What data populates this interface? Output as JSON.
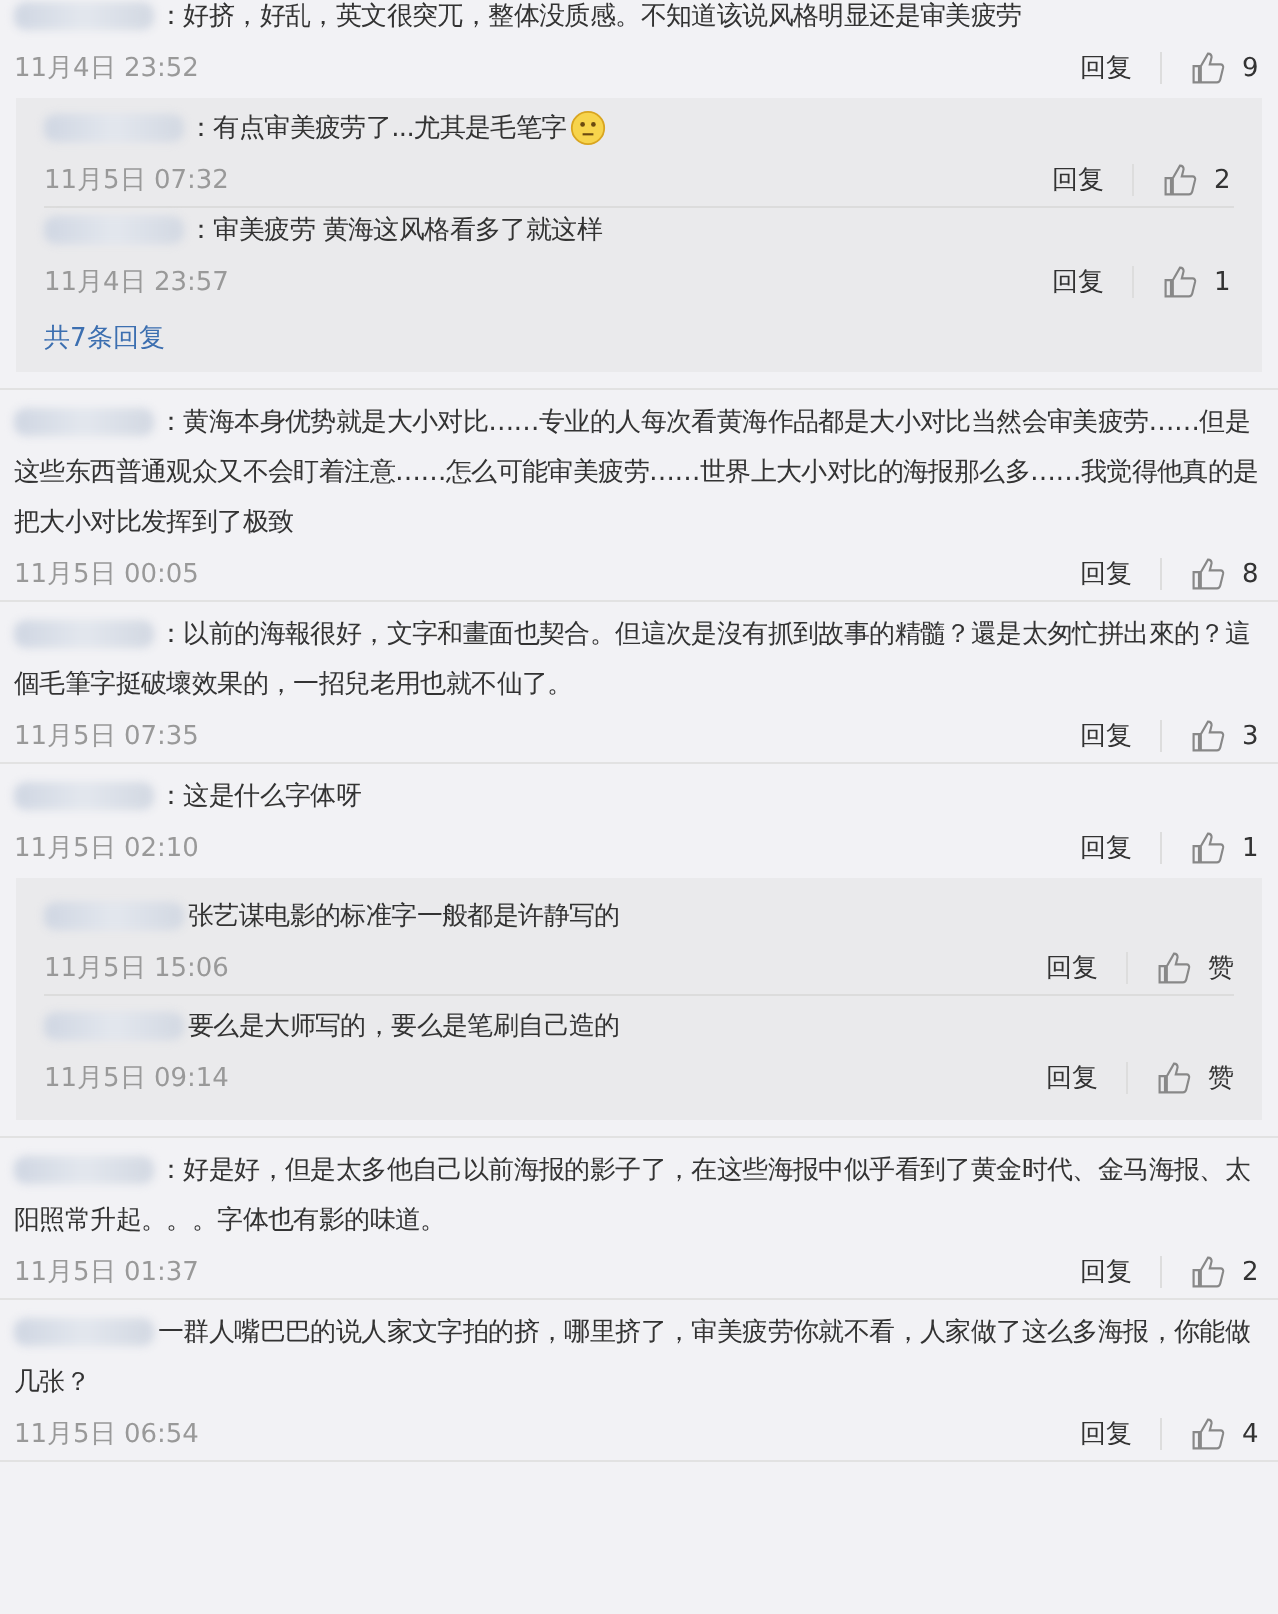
{
  "comments": [
    {
      "text": "：好挤，好乱，英文很突兀，整体没质感。不知道该说风格明显还是审美疲劳",
      "time": "11月4日 23:52",
      "reply_label": "回复",
      "likes": "9",
      "replies": [
        {
          "text": "：有点审美疲劳了...尤其是毛笔字",
          "emoji": true,
          "time": "11月5日 07:32",
          "reply_label": "回复",
          "likes": "2"
        },
        {
          "text": "：审美疲劳 黄海这风格看多了就这样",
          "emoji": false,
          "time": "11月4日 23:57",
          "reply_label": "回复",
          "likes": "1"
        }
      ],
      "more": "共7条回复"
    },
    {
      "text": "：黄海本身优势就是大小对比……专业的人每次看黄海作品都是大小对比当然会审美疲劳……但是这些东西普通观众又不会盯着注意……怎么可能审美疲劳……世界上大小对比的海报那么多……我觉得他真的是把大小对比发挥到了极致",
      "time": "11月5日 00:05",
      "reply_label": "回复",
      "likes": "8"
    },
    {
      "text": "：以前的海報很好，文字和畫面也契合。但這次是沒有抓到故事的精髓？還是太匆忙拼出來的？這個毛筆字挺破壞效果的，一招兒老用也就不仙了。",
      "time": "11月5日 07:35",
      "reply_label": "回复",
      "likes": "3"
    },
    {
      "text": "：这是什么字体呀",
      "time": "11月5日 02:10",
      "reply_label": "回复",
      "likes": "1",
      "replies": [
        {
          "text": "张艺谋电影的标准字一般都是许静写的",
          "emoji": false,
          "time": "11月5日 15:06",
          "reply_label": "回复",
          "likes": "赞"
        },
        {
          "text": "要么是大师写的，要么是笔刷自己造的",
          "emoji": false,
          "time": "11月5日 09:14",
          "reply_label": "回复",
          "likes": "赞"
        }
      ]
    },
    {
      "text": "：好是好，但是太多他自己以前海报的影子了，在这些海报中似乎看到了黄金时代、金马海报、太阳照常升起。。。字体也有影的味道。",
      "time": "11月5日 01:37",
      "reply_label": "回复",
      "likes": "2"
    },
    {
      "text": "一群人嘴巴巴的说人家文字拍的挤，哪里挤了，审美疲劳你就不看，人家做了这么多海报，你能做几张？",
      "time": "11月5日 06:54",
      "reply_label": "回复",
      "likes": "4"
    }
  ]
}
